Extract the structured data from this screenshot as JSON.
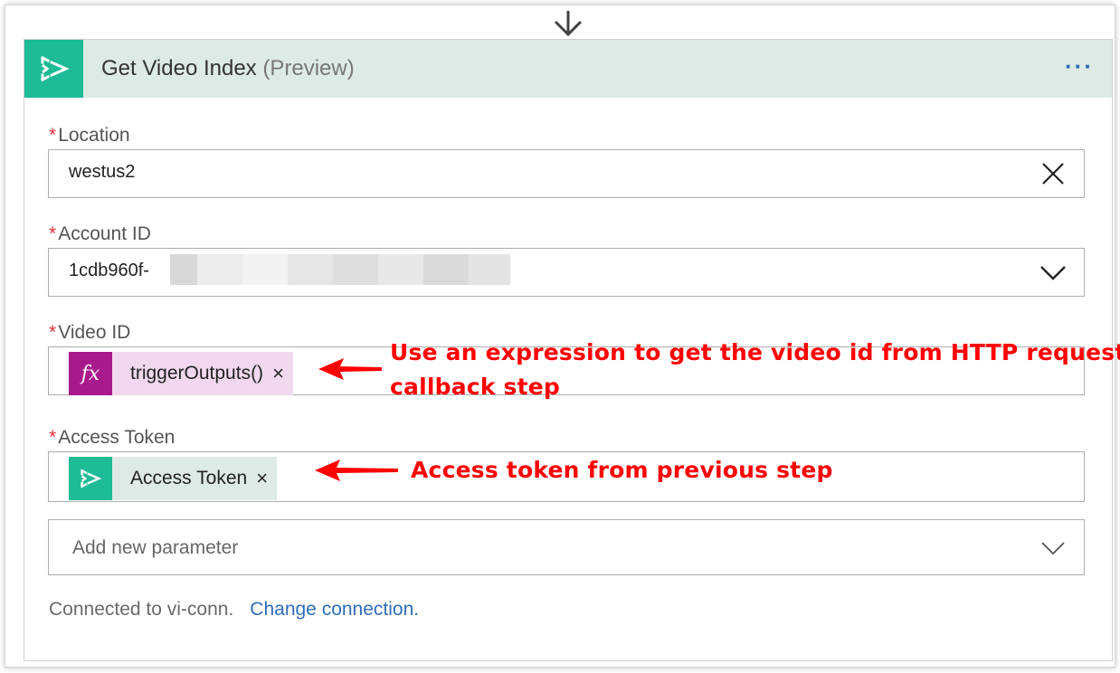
{
  "action": {
    "title": "Get Video Index",
    "subtitle": "(Preview)",
    "more_label": "···"
  },
  "fields": {
    "location": {
      "required_mark": "*",
      "label": "Location",
      "value": "westus2"
    },
    "account_id": {
      "required_mark": "*",
      "label": "Account ID",
      "value": "1cdb960f-"
    },
    "video_id": {
      "required_mark": "*",
      "label": "Video ID",
      "token_label": "triggerOutputs()",
      "token_remove": "×",
      "token_icon": "fx-expression-icon"
    },
    "access_token": {
      "required_mark": "*",
      "label": "Access Token",
      "token_label": "Access Token",
      "token_remove": "×",
      "token_icon": "video-indexer-icon"
    }
  },
  "add_parameter": {
    "placeholder": "Add new parameter"
  },
  "connection": {
    "text": "Connected to vi-conn.",
    "change_link": "Change connection."
  },
  "annotations": {
    "video_id_line1": "Use an expression to get the video id from HTTP request",
    "video_id_line2": "callback step",
    "access_token": "Access token from previous step"
  },
  "colors": {
    "brand_green": "#1dbb96",
    "header_bg": "#ddeae6",
    "expression_purple": "#a8198c",
    "expression_token_bg": "#f1d8ee",
    "dynamic_token_bg": "#ddeae6",
    "link_blue": "#2f6db5",
    "required_red": "#e0323d",
    "annotation_red": "#ff0000"
  }
}
